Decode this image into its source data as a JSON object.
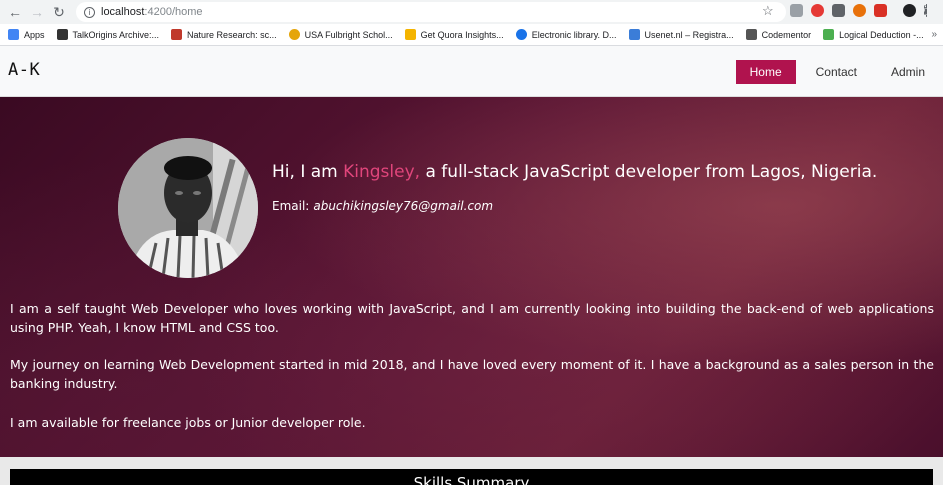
{
  "browser": {
    "url_host": "localhost",
    "url_path": ":4200/home",
    "bookmarks": [
      {
        "label": "Apps",
        "color": "#4285f4"
      },
      {
        "label": "TalkOrigins Archive:...",
        "color": "#333333"
      },
      {
        "label": "Nature Research: sc...",
        "color": "#c0392b"
      },
      {
        "label": "USA Fulbright Schol...",
        "color": "#e5a50a"
      },
      {
        "label": "Get Quora Insights...",
        "color": "#f4b400"
      },
      {
        "label": "Electronic library. D...",
        "color": "#1a73e8"
      },
      {
        "label": "Usenet.nl – Registra...",
        "color": "#3b7dd8"
      },
      {
        "label": "Codementor",
        "color": "#555555"
      },
      {
        "label": "Logical Deduction -...",
        "color": "#4caf50"
      }
    ],
    "more": "»"
  },
  "site": {
    "brand": "A-K",
    "nav": {
      "home": "Home",
      "contact": "Contact",
      "admin": "Admin"
    },
    "accent": "#b0134e"
  },
  "hero": {
    "intro_prefix": "Hi, I am ",
    "name": "Kingsley,",
    "intro_suffix": " a full-stack JavaScript developer from Lagos, Nigeria.",
    "email_label": "Email:",
    "email": "abuchikingsley76@gmail.com",
    "p1": "I am a self taught Web Developer who loves working with JavaScript, and I am currently looking into building the back-end of web applications using PHP. Yeah, I know HTML and CSS too.",
    "p2": "My journey on learning Web Development started in mid 2018, and I have loved every moment of it. I have a background as a sales person in the banking industry.",
    "p3": "I am available for freelance jobs or Junior developer role."
  },
  "skills": {
    "title": "Skills Summary"
  }
}
